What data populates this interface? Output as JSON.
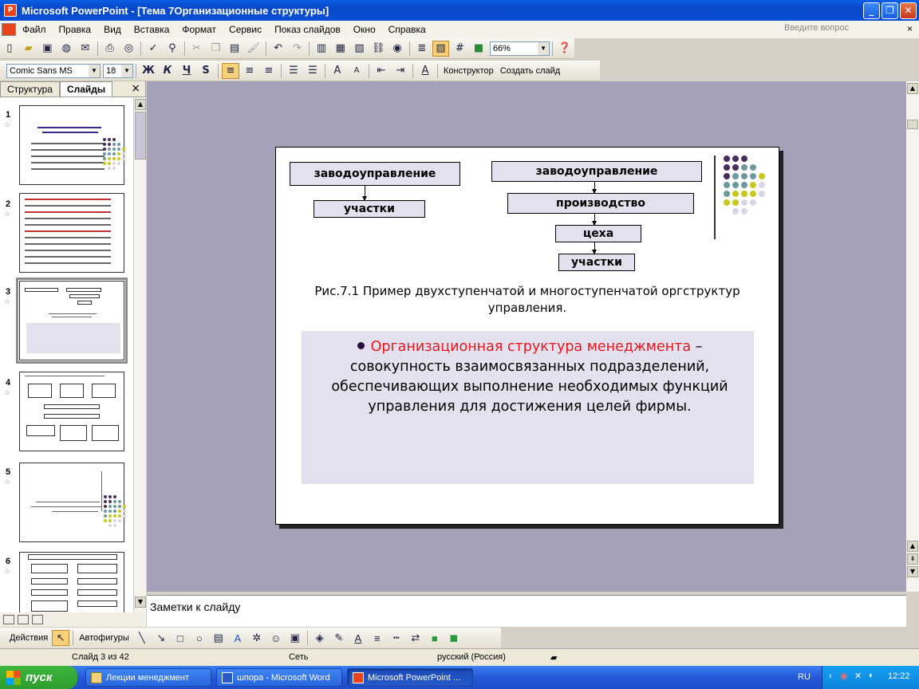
{
  "window": {
    "title": "Microsoft PowerPoint - [Тема 7Организационные структуры]",
    "btn_minimize": "_",
    "btn_restore": "❐",
    "btn_close": "✕"
  },
  "menu": {
    "items": [
      "Файл",
      "Правка",
      "Вид",
      "Вставка",
      "Формат",
      "Сервис",
      "Показ слайдов",
      "Окно",
      "Справка"
    ],
    "ask_placeholder": "Введите вопрос",
    "close": "×"
  },
  "toolbar_standard": {
    "zoom": "66%"
  },
  "toolbar_format": {
    "font": "Comic Sans MS",
    "size": "18",
    "bold": "Ж",
    "italic": "К",
    "underline": "Ч",
    "shadow": "S",
    "designer": "Конструктор",
    "new_slide": "Создать слайд"
  },
  "left_pane": {
    "tab_outline": "Структура",
    "tab_slides": "Слайды",
    "close": "×",
    "thumb_numbers": [
      "1",
      "2",
      "3",
      "4",
      "5",
      "6"
    ]
  },
  "slide": {
    "left_chart": {
      "top": "заводоуправление",
      "bottom": "участки"
    },
    "right_chart": {
      "top": "заводоуправление",
      "level2": "производство",
      "level3": "цеха",
      "level4": "участки"
    },
    "caption": "Рис.7.1 Пример двухступенчатой и многоступенчатой оргструктур управления.",
    "term": "Организационная структура менеджмента",
    "definition": " – совокупность взаимосвязанных подразделений, обеспечивающих выполнение необходимых функций управления для достижения целей фирмы."
  },
  "notes_placeholder": "Заметки к слайду",
  "draw_toolbar": {
    "actions": "Действия",
    "autoshapes": "Автофигуры"
  },
  "status": {
    "slide": "Слайд 3 из 42",
    "design": "Сеть",
    "language": "русский (Россия)"
  },
  "taskbar": {
    "start": "пуск",
    "tasks": [
      "Лекции менеджмент",
      "шпора - Microsoft Word",
      "Microsoft PowerPoint ..."
    ],
    "lang": "RU",
    "clock": "12:22"
  },
  "colors": {
    "dot_dark": "#4a2c5a",
    "dot_teal": "#6a9a9e",
    "dot_yellow": "#c8c81e",
    "dot_light": "#d8d6e6",
    "accent_red": "#e8151b"
  }
}
